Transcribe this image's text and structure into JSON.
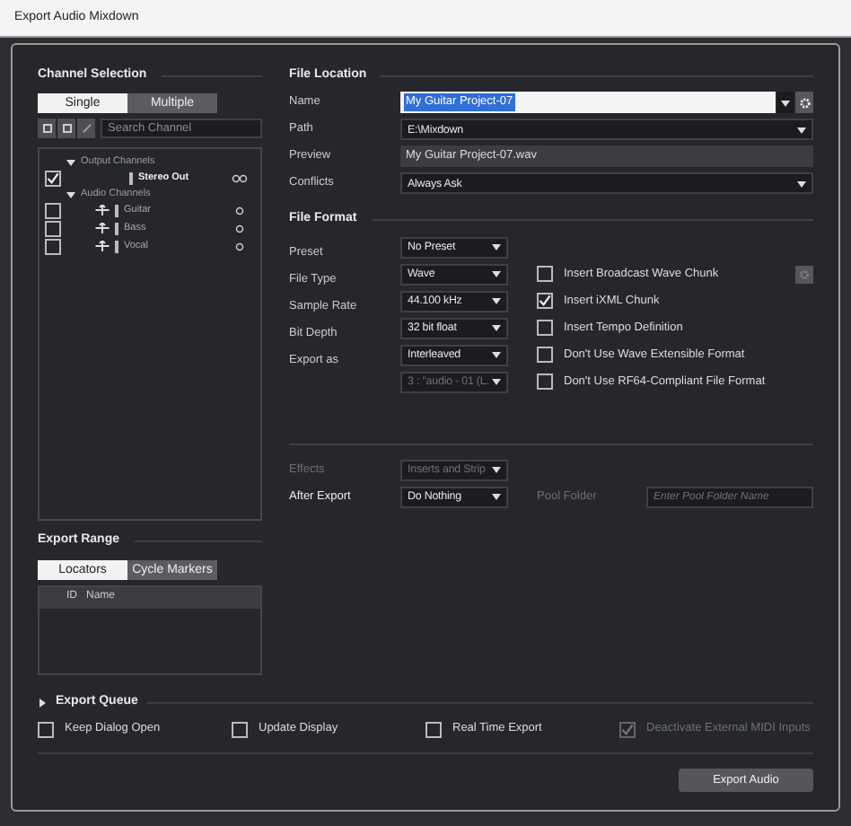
{
  "window": {
    "title": "Export Audio Mixdown"
  },
  "channel_selection": {
    "title": "Channel Selection",
    "tabs": [
      {
        "label": "Single",
        "selected": true
      },
      {
        "label": "Multiple",
        "selected": false
      }
    ],
    "search": {
      "placeholder": "Search Channel"
    },
    "tree": [
      {
        "label": "Output Channels",
        "expanded": true,
        "children": [
          {
            "label": "Stereo Out",
            "checked": true,
            "kind": "stereo"
          }
        ]
      },
      {
        "label": "Audio Channels",
        "expanded": true,
        "children": [
          {
            "label": "Guitar",
            "checked": false,
            "kind": "mono"
          },
          {
            "label": "Bass",
            "checked": false,
            "kind": "mono"
          },
          {
            "label": "Vocal",
            "checked": false,
            "kind": "mono"
          }
        ]
      }
    ]
  },
  "export_range": {
    "title": "Export Range",
    "tabs": [
      {
        "label": "Locators",
        "selected": true
      },
      {
        "label": "Cycle Markers",
        "selected": false
      }
    ],
    "columns": [
      "ID",
      "Name"
    ]
  },
  "file_location": {
    "title": "File Location",
    "fields": [
      {
        "kind": "name",
        "label": "Name",
        "value": "My Guitar Project-07"
      },
      {
        "kind": "dropdown",
        "label": "Path",
        "value": "E:\\Mixdown"
      },
      {
        "kind": "readonly",
        "label": "Preview",
        "value": "My Guitar Project-07.wav"
      },
      {
        "kind": "dropdown",
        "label": "Conflicts",
        "value": "Always Ask"
      }
    ]
  },
  "file_format": {
    "title": "File Format",
    "settings": [
      {
        "label": "Preset",
        "value": "No Preset",
        "disabled": false
      },
      {
        "label": "File Type",
        "value": "Wave",
        "disabled": false
      },
      {
        "label": "Sample Rate",
        "value": "44.100 kHz",
        "disabled": false
      },
      {
        "label": "Bit Depth",
        "value": "32 bit float",
        "disabled": false
      },
      {
        "label": "Export as",
        "value": "Interleaved",
        "disabled": false
      },
      {
        "value": "3 : \"audio - 01 (L.",
        "disabled": true
      }
    ],
    "options": [
      {
        "label": "Insert Broadcast Wave Chunk",
        "checked": false
      },
      {
        "label": "Insert iXML Chunk",
        "checked": true
      },
      {
        "label": "Insert Tempo Definition",
        "checked": false
      },
      {
        "label": "Don't Use Wave Extensible Format",
        "checked": false
      },
      {
        "label": "Don't Use RF64-Compliant File Format",
        "checked": false
      }
    ]
  },
  "post": {
    "effects": {
      "label": "Effects",
      "value": "Inserts and Strip",
      "disabled": true
    },
    "after_export": {
      "label": "After Export",
      "value": "Do Nothing",
      "disabled": false
    },
    "pool_folder": {
      "label": "Pool Folder",
      "placeholder": "Enter Pool Folder Name",
      "disabled": true
    }
  },
  "export_queue": {
    "title": "Export Queue",
    "expanded": false,
    "options": [
      {
        "label": "Keep Dialog Open",
        "checked": false,
        "disabled": false
      },
      {
        "label": "Update Display",
        "checked": false,
        "disabled": false
      },
      {
        "label": "Real Time Export",
        "checked": false,
        "disabled": false
      },
      {
        "label": "Deactivate External MIDI Inputs",
        "checked": true,
        "disabled": true
      }
    ]
  },
  "button": "Export Audio"
}
